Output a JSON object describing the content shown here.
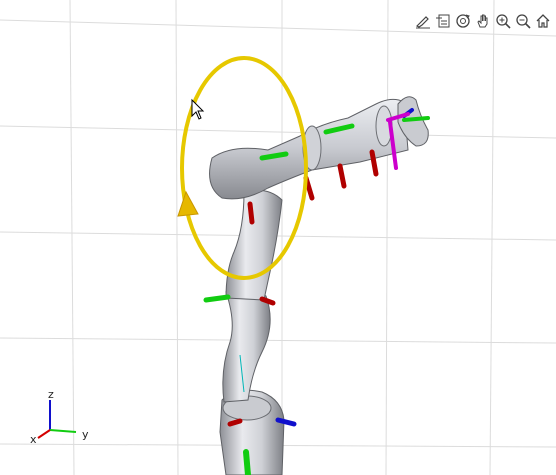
{
  "toolbar": {
    "items": [
      {
        "name": "brush-icon"
      },
      {
        "name": "legend-icon"
      },
      {
        "name": "rotate-3d-icon"
      },
      {
        "name": "pan-hand-icon"
      },
      {
        "name": "zoom-in-icon"
      },
      {
        "name": "zoom-out-icon"
      },
      {
        "name": "home-icon"
      }
    ]
  },
  "axes_triad": {
    "x": "x",
    "y": "y",
    "z": "z"
  },
  "colors": {
    "x_axis": "#d40000",
    "y_axis": "#00cc00",
    "z_axis": "#0000cc",
    "rotation_ring": "#e6c800",
    "end_effector_frame": "#cc00cc",
    "robot_body": "#d8dadf",
    "grid": "#dcdcdc"
  }
}
